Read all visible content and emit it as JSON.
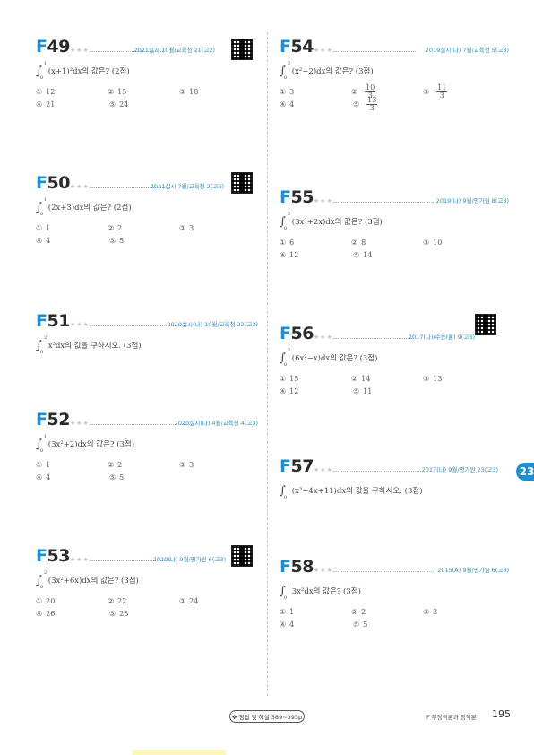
{
  "problems": [
    {
      "code_letter": "F",
      "code_num": "49",
      "stars": "★★★",
      "source": "2021실시 10월/교육청 21(고2)",
      "qr": true,
      "integrand": "(x+1)²dx의 값은? (2점)",
      "lim_a": "1",
      "lim_b": "0",
      "choices": [
        {
          "n": "①",
          "v": "12"
        },
        {
          "n": "②",
          "v": "15"
        },
        {
          "n": "③",
          "v": "18"
        },
        {
          "n": "④",
          "v": "21"
        },
        {
          "n": "⑤",
          "v": "24"
        }
      ]
    },
    {
      "code_letter": "F",
      "code_num": "50",
      "stars": "★★★",
      "source": "2021실시 7월/교육청 2(고3)",
      "qr": true,
      "integrand": "(2x+3)dx의 값은? (2점)",
      "lim_a": "1",
      "lim_b": "0",
      "choices": [
        {
          "n": "①",
          "v": "1"
        },
        {
          "n": "②",
          "v": "2"
        },
        {
          "n": "③",
          "v": "3"
        },
        {
          "n": "④",
          "v": "4"
        },
        {
          "n": "⑤",
          "v": "5"
        }
      ]
    },
    {
      "code_letter": "F",
      "code_num": "51",
      "stars": "★★★",
      "source": "2020실시(나) 10월/교육청 22(고3)",
      "qr": false,
      "integrand": "x³dx의 값을 구하시오. (3점)",
      "lim_a": "2",
      "lim_b": "0",
      "choices": []
    },
    {
      "code_letter": "F",
      "code_num": "52",
      "stars": "★★★",
      "source": "2020실시(나) 4월/교육청 4(고3)",
      "qr": false,
      "integrand": "(3x²+2)dx의 값은? (3점)",
      "lim_a": "1",
      "lim_b": "0",
      "choices": [
        {
          "n": "①",
          "v": "1"
        },
        {
          "n": "②",
          "v": "2"
        },
        {
          "n": "③",
          "v": "3"
        },
        {
          "n": "④",
          "v": "4"
        },
        {
          "n": "⑤",
          "v": "5"
        }
      ]
    },
    {
      "code_letter": "F",
      "code_num": "53",
      "stars": "★★★",
      "source": "2020(나) 9월/평가원 6(고3)",
      "qr": true,
      "integrand": "(3x²+6x)dx의 값은? (3점)",
      "lim_a": "2",
      "lim_b": "0",
      "choices": [
        {
          "n": "①",
          "v": "20"
        },
        {
          "n": "②",
          "v": "22"
        },
        {
          "n": "③",
          "v": "24"
        },
        {
          "n": "④",
          "v": "26"
        },
        {
          "n": "⑤",
          "v": "28"
        }
      ]
    },
    {
      "code_letter": "F",
      "code_num": "54",
      "stars": "★★★",
      "source": "2019실시(나) 7월/교육청 5(고3)",
      "qr": false,
      "integrand": "(x²−2)dx의 값은? (3점)",
      "lim_a": "2",
      "lim_b": "0",
      "choices": [
        {
          "n": "①",
          "v": "3"
        },
        {
          "n": "②",
          "num": "10",
          "den": "3"
        },
        {
          "n": "③",
          "num": "11",
          "den": "3"
        },
        {
          "n": "④",
          "v": "4"
        },
        {
          "n": "⑤",
          "num": "13",
          "den": "3"
        }
      ]
    },
    {
      "code_letter": "F",
      "code_num": "55",
      "stars": "★★★",
      "source": "2019(나) 9월/평가원 8(고3)",
      "qr": false,
      "integrand": "(3x²+2x)dx의 값은? (3점)",
      "lim_a": "2",
      "lim_b": "0",
      "choices": [
        {
          "n": "①",
          "v": "6"
        },
        {
          "n": "②",
          "v": "8"
        },
        {
          "n": "③",
          "v": "10"
        },
        {
          "n": "④",
          "v": "12"
        },
        {
          "n": "⑤",
          "v": "14"
        }
      ]
    },
    {
      "code_letter": "F",
      "code_num": "56",
      "stars": "★★★",
      "source": "2017(나)/수능(홀) 9(고3)",
      "qr": true,
      "integrand": "(6x²−x)dx의 값은? (3점)",
      "lim_a": "2",
      "lim_b": "0",
      "choices": [
        {
          "n": "①",
          "v": "15"
        },
        {
          "n": "②",
          "v": "14"
        },
        {
          "n": "③",
          "v": "13"
        },
        {
          "n": "④",
          "v": "12"
        },
        {
          "n": "⑤",
          "v": "11"
        }
      ]
    },
    {
      "code_letter": "F",
      "code_num": "57",
      "stars": "★★★",
      "source": "2017(나) 9월/평가원 23(고3)",
      "qr": false,
      "integrand": "(x³−4x+11)dx의 값을 구하시오. (3점)",
      "lim_a": "1",
      "lim_b": "0",
      "choices": []
    },
    {
      "code_letter": "F",
      "code_num": "58",
      "stars": "★★★",
      "source": "2015(A) 9월/평가원 6(고3)",
      "qr": false,
      "integrand": "3x²dx의 값은? (3점)",
      "lim_a": "1",
      "lim_b": "0",
      "choices": [
        {
          "n": "①",
          "v": "1"
        },
        {
          "n": "②",
          "v": "2"
        },
        {
          "n": "③",
          "v": "3"
        },
        {
          "n": "④",
          "v": "4"
        },
        {
          "n": "⑤",
          "v": "5"
        }
      ]
    }
  ],
  "footer": {
    "answer_link": "❖ 정답 및 해설 389~393p",
    "chapter": "F 부정적분과 정적분",
    "page": "195",
    "side_tab": "23"
  },
  "colors": {
    "accent": "#1a8fd6",
    "text": "#333333"
  }
}
